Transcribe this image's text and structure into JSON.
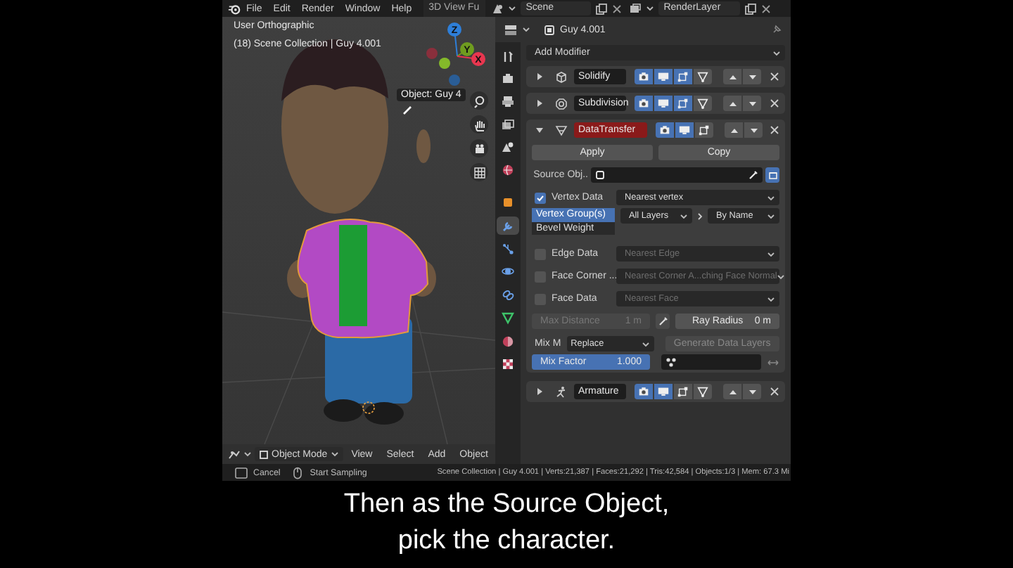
{
  "top_bar": {
    "menus": [
      "File",
      "Edit",
      "Render",
      "Window",
      "Help"
    ],
    "workspace_tab": "3D View Fu",
    "scene": "Scene",
    "view_layer": "RenderLayer"
  },
  "viewport": {
    "view_name": "User Orthographic",
    "collection_info": "(18) Scene Collection | Guy 4.001",
    "gizmo_axes": [
      {
        "label": "Z",
        "color": "#2e7fd9"
      },
      {
        "label": "Y",
        "color": "#6f9c1f"
      },
      {
        "label": "X",
        "color": "#e8364f"
      }
    ],
    "eyedropper_tooltip": "Object: Guy 4",
    "mode": "Object Mode",
    "menus": [
      "View",
      "Select",
      "Add",
      "Object"
    ]
  },
  "properties": {
    "object_name": "Guy 4.001",
    "tabs": [
      {
        "kind": "tool",
        "selected": false
      },
      {
        "kind": "render",
        "selected": false
      },
      {
        "kind": "output",
        "selected": false
      },
      {
        "kind": "view_layer",
        "selected": false
      },
      {
        "kind": "scene",
        "selected": false
      },
      {
        "kind": "world",
        "selected": false
      },
      {
        "kind": "object",
        "selected": false
      },
      {
        "kind": "modifiers",
        "selected": true
      },
      {
        "kind": "particles",
        "selected": false
      },
      {
        "kind": "physics",
        "selected": false
      },
      {
        "kind": "constraints",
        "selected": false
      },
      {
        "kind": "data",
        "selected": false
      },
      {
        "kind": "material",
        "selected": false
      },
      {
        "kind": "texture",
        "selected": false
      }
    ],
    "add_modifier": "Add Modifier",
    "modifiers": [
      {
        "kind": "solidify",
        "name": "Solidify",
        "expanded": false,
        "error": false,
        "render": true,
        "viewport": true,
        "edit_mode": true,
        "on_cage": false
      },
      {
        "kind": "subdivision",
        "name": "Subdivision",
        "expanded": false,
        "error": false,
        "render": true,
        "viewport": true,
        "edit_mode": true,
        "on_cage": false
      },
      {
        "kind": "data_transfer",
        "name": "DataTransfer",
        "expanded": true,
        "error": true,
        "render": true,
        "viewport": true,
        "edit_mode": false,
        "settings": {
          "apply": "Apply",
          "copy": "Copy",
          "source_label": "Source Obj..",
          "eyedropper_active": true,
          "data_types": [
            {
              "label": "Vertex Data",
              "checked": true,
              "mapping": "Nearest vertex"
            },
            {
              "label": "Edge Data",
              "checked": false,
              "mapping": "Nearest Edge"
            },
            {
              "label": "Face Corner ...",
              "checked": false,
              "mapping": "Nearest Corner A...ching Face Normal"
            },
            {
              "label": "Face Data",
              "checked": false,
              "mapping": "Nearest Face"
            }
          ],
          "vertex_types": [
            {
              "label": "Vertex Group(s)",
              "selected": true
            },
            {
              "label": "Bevel Weight",
              "selected": false
            }
          ],
          "layers_source": "All Layers",
          "layers_destination": "By Name",
          "max_distance": {
            "label": "Max Distance",
            "value": "1 m",
            "disabled": true
          },
          "ray_radius": {
            "label": "Ray Radius",
            "value": "0 m"
          },
          "mix_mode_label": "Mix M",
          "mix_mode": "Replace",
          "generate_data_layers": {
            "label": "Generate Data Layers",
            "disabled": true
          },
          "mix_factor": {
            "label": "Mix Factor",
            "value": "1.000",
            "level": 1
          }
        }
      },
      {
        "kind": "armature",
        "name": "Armature",
        "expanded": false,
        "error": false,
        "render": true,
        "viewport": true,
        "edit_mode": false,
        "on_cage": false
      }
    ]
  },
  "status_bar": {
    "hints": [
      {
        "kind": "escape",
        "label": "Cancel"
      },
      {
        "kind": "mouse",
        "label": "Start Sampling"
      }
    ],
    "stats": "Scene Collection | Guy 4.001 | Verts:21,387 | Faces:21,292 | Tris:42,584 | Objects:1/3 | Mem: 67.3 Mi"
  },
  "caption": {
    "lines": [
      "Then as the Source Object,",
      "pick the character."
    ]
  }
}
